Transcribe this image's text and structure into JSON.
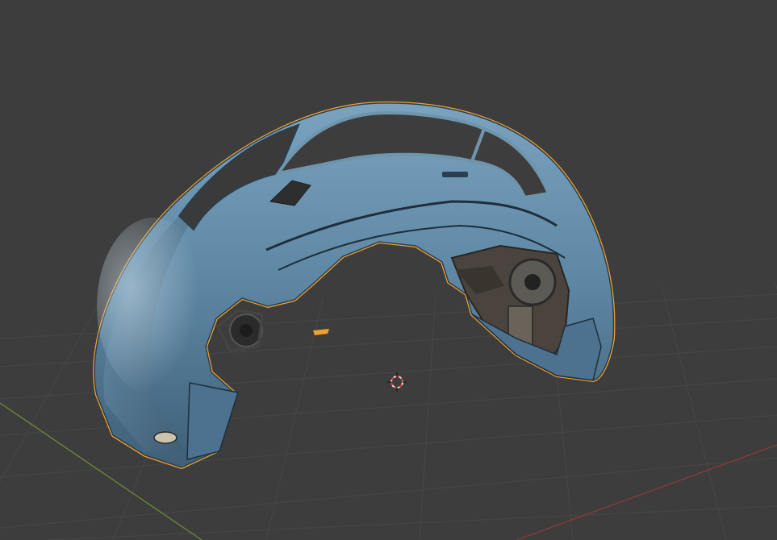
{
  "viewport": {
    "background": "#3d3d3d",
    "grid_color": "#4a4a4a",
    "x_axis_color": "#8a3a3a",
    "y_axis_color": "#6c8a3a"
  },
  "selection": {
    "outline_color": "#f0a030",
    "object_color": "#5d86a3"
  },
  "cursor": {
    "icon": "3d-cursor-icon"
  }
}
